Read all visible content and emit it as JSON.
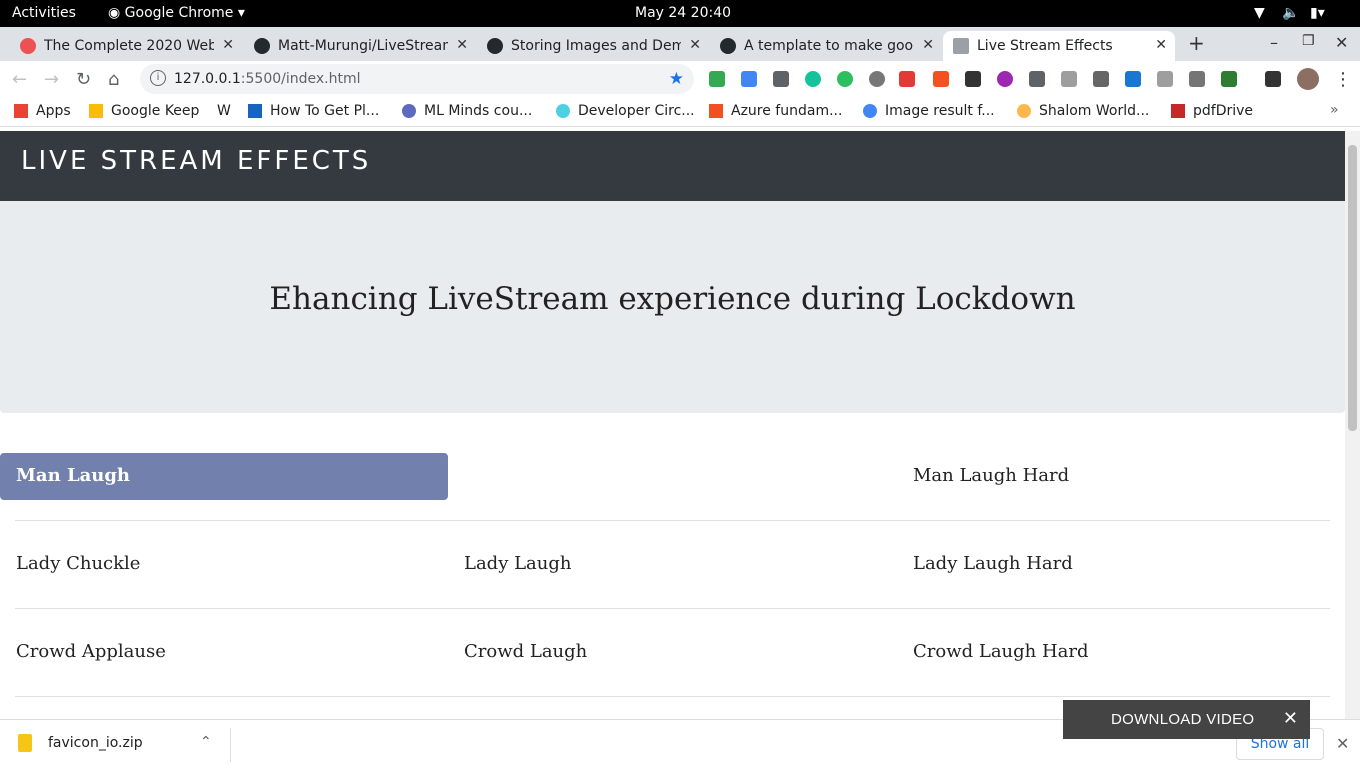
{
  "system": {
    "activities": "Activities",
    "app": "Google Chrome",
    "datetime": "May 24  20:40"
  },
  "tabs": [
    {
      "title": "The Complete 2020 Web D",
      "icon": "udemy-icon"
    },
    {
      "title": "Matt-Murungi/LiveStream",
      "icon": "github-icon"
    },
    {
      "title": "Storing Images and Dem",
      "icon": "github-icon"
    },
    {
      "title": "A template to make good",
      "icon": "github-icon"
    },
    {
      "title": "Live Stream Effects",
      "icon": "page-icon",
      "active": true
    }
  ],
  "address": {
    "host": "127.0.0.1",
    "rest": ":5500/index.html"
  },
  "bookmarks": [
    "Apps",
    "Google Keep",
    "W",
    "How To Get Pl...",
    "ML Minds cou...",
    "Developer Circ...",
    "Azure fundam...",
    "Image result f...",
    "Shalom World...",
    "pdfDrive"
  ],
  "site": {
    "brand": "LIVE STREAM EFFECTS",
    "headline": "Ehancing LiveStream experience during Lockdown",
    "effects": [
      [
        "Man Laugh",
        "",
        "Man Laugh Hard"
      ],
      [
        "Lady Chuckle",
        "Lady Laugh",
        "Lady Laugh Hard"
      ],
      [
        "Crowd Applause",
        "Crowd Laugh",
        "Crowd Laugh Hard"
      ]
    ]
  },
  "downloads": {
    "file": "favicon_io.zip",
    "show_all": "Show all"
  },
  "toast": {
    "label": "DOWNLOAD VIDEO"
  },
  "colors": {
    "navbar": "#343a40",
    "jumbotron": "#e9ecef",
    "active_effect": "#7180ac",
    "toast": "#444444"
  }
}
